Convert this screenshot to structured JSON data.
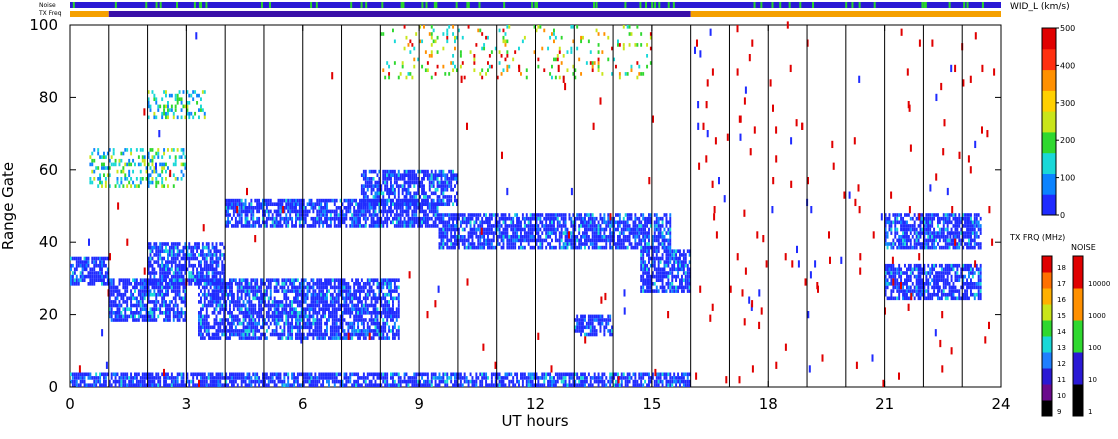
{
  "chart_data": {
    "type": "heatmap",
    "title": "",
    "xlabel": "UT hours",
    "ylabel": "Range Gate",
    "x_range": [
      0,
      24
    ],
    "y_range": [
      0,
      100
    ],
    "x_ticks": [
      "0",
      "3",
      "6",
      "9",
      "12",
      "15",
      "18",
      "21",
      "24"
    ],
    "y_ticks": [
      "0",
      "20",
      "40",
      "60",
      "80",
      "100"
    ],
    "top_bars": {
      "noise_label": "Noise",
      "txfreq_label": "TX Freq",
      "noise_base_color": "#2a19d4",
      "noise_speck_color": "#2bd42b",
      "txfreq_segments": [
        {
          "start": 0,
          "end": 1,
          "color": "#f5a000"
        },
        {
          "start": 1,
          "end": 16,
          "color": "#3a0fa8"
        },
        {
          "start": 16,
          "end": 24,
          "color": "#f5a000"
        }
      ]
    },
    "colorbars": {
      "width": {
        "title": "WID_L (km/s)",
        "ticks": [
          "0",
          "100",
          "200",
          "300",
          "400",
          "500"
        ],
        "range": [
          0,
          500
        ],
        "colors": [
          "#1f2bff",
          "#0b83ff",
          "#19d8d8",
          "#2fd82f",
          "#c9e51a",
          "#ffd000",
          "#ff9000",
          "#ff3010",
          "#e00000"
        ]
      },
      "txfreq": {
        "title": "TX FRQ (MHz)",
        "ticks": [
          "9",
          "10",
          "11",
          "12",
          "13",
          "14",
          "15",
          "16",
          "17",
          "18"
        ],
        "colors": [
          "#000000",
          "#6a0a8c",
          "#2a19d4",
          "#1f7fff",
          "#19d8d8",
          "#2fd82f",
          "#c9e51a",
          "#ffb000",
          "#ff7000",
          "#e00000"
        ]
      },
      "noise": {
        "title": "NOISE",
        "ticks": [
          "1",
          "10",
          "100",
          "1000",
          "10000"
        ],
        "colors": [
          "#000000",
          "#2a19d4",
          "#2fd82f",
          "#ff9000",
          "#e00000"
        ]
      }
    },
    "echo_regions": [
      {
        "t0": 0.0,
        "t1": 1.0,
        "g0": 28,
        "g1": 36,
        "level": "low"
      },
      {
        "t0": 1.0,
        "t1": 3.0,
        "g0": 18,
        "g1": 30,
        "level": "low"
      },
      {
        "t0": 3.3,
        "t1": 8.5,
        "g0": 13,
        "g1": 30,
        "level": "low"
      },
      {
        "t0": 2.0,
        "t1": 4.0,
        "g0": 28,
        "g1": 40,
        "level": "low"
      },
      {
        "t0": 4.0,
        "t1": 9.5,
        "g0": 44,
        "g1": 52,
        "level": "low"
      },
      {
        "t0": 7.5,
        "t1": 10.0,
        "g0": 50,
        "g1": 60,
        "level": "low"
      },
      {
        "t0": 9.5,
        "t1": 15.5,
        "g0": 38,
        "g1": 48,
        "level": "low"
      },
      {
        "t0": 14.7,
        "t1": 16.0,
        "g0": 26,
        "g1": 38,
        "level": "low"
      },
      {
        "t0": 13.0,
        "t1": 14.0,
        "g0": 14,
        "g1": 20,
        "level": "low"
      },
      {
        "t0": 21.0,
        "t1": 23.5,
        "g0": 38,
        "g1": 48,
        "level": "low"
      },
      {
        "t0": 21.0,
        "t1": 23.5,
        "g0": 24,
        "g1": 34,
        "level": "low"
      },
      {
        "t0": 2.0,
        "t1": 3.5,
        "g0": 74,
        "g1": 82,
        "level": "mid"
      },
      {
        "t0": 0.5,
        "t1": 3.0,
        "g0": 55,
        "g1": 66,
        "level": "mid"
      },
      {
        "t0": 0.0,
        "t1": 16.0,
        "g0": 0,
        "g1": 4,
        "level": "low"
      },
      {
        "t0": 8.0,
        "t1": 15.0,
        "g0": 85,
        "g1": 100,
        "level": "high"
      }
    ]
  }
}
